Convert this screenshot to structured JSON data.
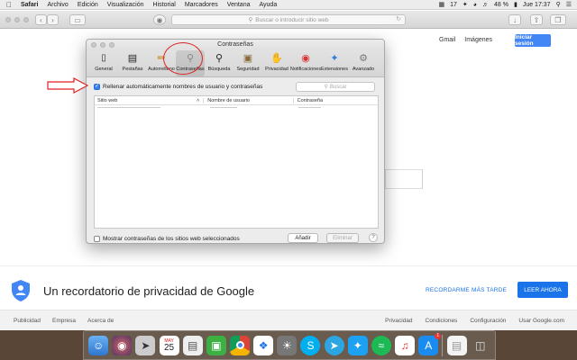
{
  "menubar": {
    "apple": "",
    "app": "Safari",
    "items": [
      "Archivo",
      "Edición",
      "Visualización",
      "Historial",
      "Marcadores",
      "Ventana",
      "Ayuda"
    ],
    "battery": "48 %",
    "clock": "Jue 17:37",
    "notif_count": "17"
  },
  "toolbar": {
    "url_placeholder": "Buscar o introducir sitio web"
  },
  "google": {
    "links": [
      "Gmail",
      "Imágenes"
    ],
    "signin": "Iniciar sesión",
    "privacy_text": "Un recordatorio de privacidad de Google",
    "remind_later": "RECORDARME MÁS TARDE",
    "read_now": "LEER AHORA",
    "footer_left": [
      "Publicidad",
      "Empresa",
      "Acerca de"
    ],
    "footer_right": [
      "Privacidad",
      "Condiciones",
      "Configuración",
      "Usar Google.com"
    ]
  },
  "prefs": {
    "title": "Contraseñas",
    "tabs": [
      {
        "label": "General",
        "icon": "phone-icon"
      },
      {
        "label": "Pestañas",
        "icon": "tabs-icon"
      },
      {
        "label": "Autorrelleno",
        "icon": "pencil-icon"
      },
      {
        "label": "Contraseñas",
        "icon": "key-icon"
      },
      {
        "label": "Búsqueda",
        "icon": "magnifier-icon"
      },
      {
        "label": "Seguridad",
        "icon": "lock-icon"
      },
      {
        "label": "Privacidad",
        "icon": "hand-icon"
      },
      {
        "label": "Notificaciones",
        "icon": "bell-icon"
      },
      {
        "label": "Extensiones",
        "icon": "puzzle-icon"
      },
      {
        "label": "Avanzado",
        "icon": "gear-icon"
      }
    ],
    "autofill_label": "Rellenar automáticamente nombres de usuario y contraseñas",
    "search_placeholder": "Buscar",
    "columns": [
      "Sitio web",
      "Nombre de usuario",
      "Contraseña"
    ],
    "show_passwords_label": "Mostrar contraseñas de los sitios web seleccionados",
    "add_label": "Añadir",
    "remove_label": "Eliminar",
    "help": "?"
  },
  "dock": {
    "calendar_month": "MAY",
    "calendar_day": "25",
    "appstore_badge": "1"
  }
}
